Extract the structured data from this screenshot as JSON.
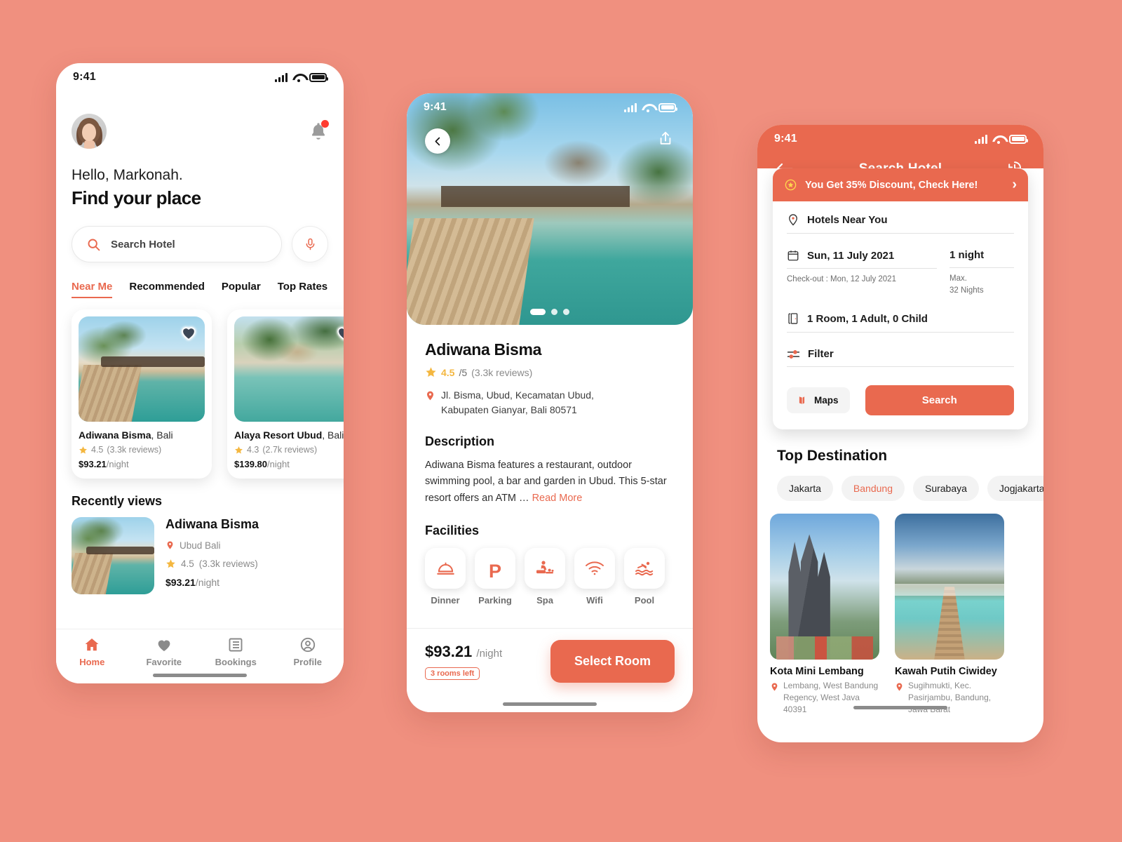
{
  "theme": {
    "accent": "#E9694F",
    "page_bg": "#F0907F",
    "star": "#F4B740",
    "muted": "#8a8a8a"
  },
  "phone_home": {
    "status": {
      "time": "9:41"
    },
    "greeting": "Hello, Markonah.",
    "headline": "Find your place",
    "search": {
      "placeholder": "Search Hotel",
      "icon": "search-icon",
      "mic_icon": "microphone-icon"
    },
    "notification": {
      "icon": "bell-icon",
      "has_badge": true
    },
    "tabs": [
      {
        "label": "Near Me",
        "active": true
      },
      {
        "label": "Recommended",
        "active": false
      },
      {
        "label": "Popular",
        "active": false
      },
      {
        "label": "Top Rates",
        "active": false
      }
    ],
    "hotel_cards": [
      {
        "name": "Adiwana Bisma",
        "city": ", Bali",
        "rating": "4.5",
        "reviews": "(3.3k reviews)",
        "price": "$93.21",
        "per": "/night"
      },
      {
        "name": "Alaya Resort Ubud",
        "city": ", Bali",
        "rating": "4.3",
        "reviews": "(2.7k reviews)",
        "price": "$139.80",
        "per": "/night"
      }
    ],
    "recent_title": "Recently views",
    "recent": {
      "name": "Adiwana Bisma",
      "location": "Ubud Bali",
      "rating": "4.5",
      "reviews": "(3.3k reviews)",
      "price": "$93.21",
      "per": "/night"
    },
    "bottom_nav": [
      {
        "label": "Home",
        "icon": "home-icon",
        "active": true
      },
      {
        "label": "Favorite",
        "icon": "heart-icon",
        "active": false
      },
      {
        "label": "Bookings",
        "icon": "list-icon",
        "active": false
      },
      {
        "label": "Profile",
        "icon": "user-circle-icon",
        "active": false
      }
    ]
  },
  "phone_detail": {
    "status": {
      "time": "9:41"
    },
    "back_icon": "chevron-left-icon",
    "share_icon": "share-icon",
    "carousel": {
      "total": 3,
      "active_index": 0
    },
    "title": "Adiwana Bisma",
    "rating": {
      "value": "4.5",
      "out_of": "/5",
      "reviews": "(3.3k reviews)"
    },
    "address_line1": "Jl. Bisma, Ubud, Kecamatan Ubud,",
    "address_line2": "Kabupaten Gianyar, Bali 80571",
    "description_heading": "Description",
    "description": "Adiwana Bisma features a restaurant, outdoor swimming pool, a bar and garden in Ubud. This 5-star resort offers an ATM …",
    "read_more": "Read More",
    "facilities_heading": "Facilities",
    "facilities": [
      {
        "label": "Dinner",
        "icon": "room-service-icon"
      },
      {
        "label": "Parking",
        "icon": "parking-icon"
      },
      {
        "label": "Spa",
        "icon": "spa-massage-icon"
      },
      {
        "label": "Wifi",
        "icon": "wifi-icon"
      },
      {
        "label": "Pool",
        "icon": "swimming-pool-icon"
      }
    ],
    "price": "$93.21",
    "price_per": "/night",
    "rooms_left": "3 rooms left",
    "cta": "Select Room"
  },
  "phone_search": {
    "status": {
      "time": "9:41"
    },
    "header": {
      "title": "Search Hotel",
      "back_icon": "arrow-left-icon",
      "history_icon": "search-history-icon"
    },
    "promo": {
      "text": "You Get 35% Discount, Check Here!",
      "icon": "star-badge-icon",
      "chevron": "›"
    },
    "location_field": {
      "value": "Hotels Near You",
      "icon": "location-pin-icon"
    },
    "date_field": {
      "value": "Sun, 11 July 2021",
      "sub": "Check-out : Mon, 12 July 2021",
      "icon": "calendar-icon"
    },
    "nights_field": {
      "value": "1 night",
      "sub_line1": "Max.",
      "sub_line2": "32 Nights"
    },
    "guest_field": {
      "value": "1 Room, 1 Adult, 0 Child",
      "icon": "door-icon"
    },
    "filter_field": {
      "value": "Filter",
      "icon": "sliders-icon"
    },
    "maps_button": {
      "label": "Maps",
      "icon": "map-icon"
    },
    "search_button": {
      "label": "Search"
    },
    "top_destination_title": "Top Destination",
    "chips": [
      {
        "label": "Jakarta",
        "selected": false
      },
      {
        "label": "Bandung",
        "selected": true
      },
      {
        "label": "Surabaya",
        "selected": false
      },
      {
        "label": "Jogjakarta",
        "selected": false
      }
    ],
    "destinations": [
      {
        "name": "Kota Mini Lembang",
        "address": "Lembang, West Bandung Regency, West Java 40391"
      },
      {
        "name": "Kawah Putih Ciwidey",
        "address": "Sugihmukti, Kec. Pasirjambu, Bandung, Jawa Barat"
      }
    ]
  }
}
